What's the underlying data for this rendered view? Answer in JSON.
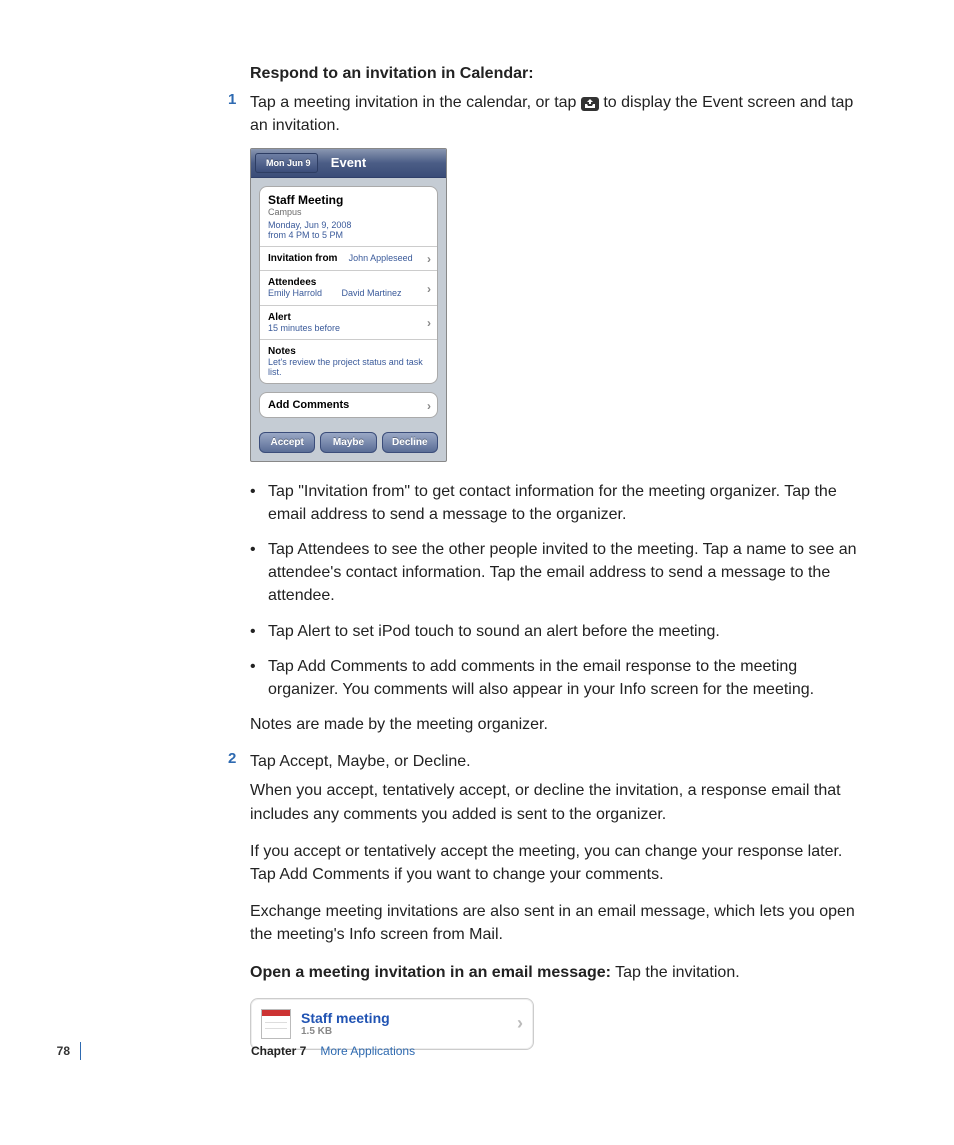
{
  "heading": "Respond to an invitation in Calendar:",
  "step1": {
    "num": "1",
    "text_before_icon": "Tap a meeting invitation in the calendar, or tap",
    "text_after_icon": "to display the Event screen and tap an invitation."
  },
  "iphone": {
    "back": "Mon Jun 9",
    "title": "Event",
    "event_title": "Staff Meeting",
    "location": "Campus",
    "date": "Monday, Jun 9, 2008",
    "time": "from 4 PM to 5 PM",
    "inv_from_label": "Invitation from",
    "inv_from_value": "John Appleseed",
    "attendees_label": "Attendees",
    "attendee1": "Emily Harrold",
    "attendee2": "David Martinez",
    "alert_label": "Alert",
    "alert_value": "15 minutes before",
    "notes_label": "Notes",
    "notes_value": "Let's review the project status and task list.",
    "add_comments": "Add Comments",
    "btn_accept": "Accept",
    "btn_maybe": "Maybe",
    "btn_decline": "Decline"
  },
  "bullets": [
    "Tap \"Invitation from\" to get contact information for the meeting organizer. Tap the email address to send a message to the organizer.",
    "Tap Attendees to see the other people invited to the meeting. Tap a name to see an attendee's contact information. Tap the email address to send a message to the attendee.",
    "Tap Alert to set iPod touch to sound an alert before the meeting.",
    "Tap Add Comments to add comments in the email response to the meeting organizer. You comments will also appear in your Info screen for the meeting."
  ],
  "notes_para": "Notes are made by the meeting organizer.",
  "step2": {
    "num": "2",
    "line1": "Tap Accept, Maybe, or Decline.",
    "line2": "When you accept, tentatively accept, or decline the invitation, a response email that includes any comments you added is sent to the organizer.",
    "line3": "If you accept or tentatively accept the meeting, you can change your response later. Tap Add Comments if you want to change your comments.",
    "line4": "Exchange meeting invitations are also sent in an email message, which lets you open the meeting's Info screen from Mail."
  },
  "open_heading": "Open a meeting invitation in an email message:",
  "open_tail": "  Tap the invitation.",
  "mail": {
    "title": "Staff meeting",
    "size": "1.5 KB"
  },
  "footer": {
    "page": "78",
    "chapter_label": "Chapter 7",
    "chapter_title": "More Applications"
  }
}
